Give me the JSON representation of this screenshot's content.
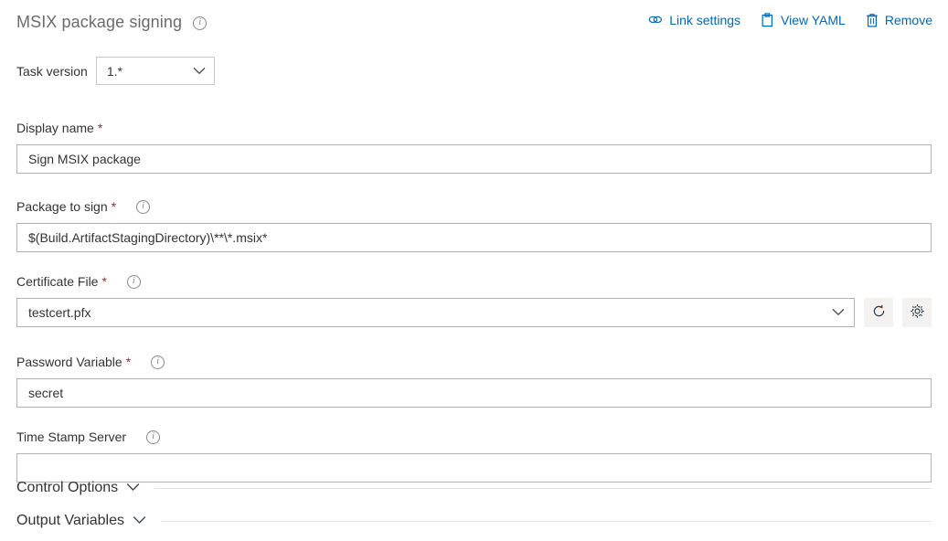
{
  "header": {
    "title": "MSIX package signing",
    "info_icon": "info-icon",
    "actions": [
      {
        "label": "Link settings",
        "icon": "link-icon"
      },
      {
        "label": "View YAML",
        "icon": "clipboard-icon"
      },
      {
        "label": "Remove",
        "icon": "trash-icon"
      }
    ]
  },
  "task_version": {
    "label": "Task version",
    "value": "1.*",
    "chevron_icon": "chevron-down-icon"
  },
  "fields": {
    "display_name": {
      "label": "Display name",
      "required": "*",
      "value": "Sign MSIX package"
    },
    "package_to_sign": {
      "label": "Package to sign",
      "required": "*",
      "info_icon": "info-icon",
      "value": "$(Build.ArtifactStagingDirectory)\\**\\*.msix*"
    },
    "certificate_file": {
      "label": "Certificate File",
      "required": "*",
      "info_icon": "info-icon",
      "value": "testcert.pfx",
      "chevron_icon": "chevron-down-icon",
      "refresh_button": "refresh-icon",
      "settings_button": "gear-icon"
    },
    "password_variable": {
      "label": "Password Variable",
      "required": "*",
      "info_icon": "info-icon",
      "value": "secret"
    },
    "time_stamp_server": {
      "label": "Time Stamp Server",
      "info_icon": "info-icon",
      "value": ""
    }
  },
  "sections": [
    {
      "title": "Control Options",
      "chevron_icon": "chevron-down-icon"
    },
    {
      "title": "Output Variables",
      "chevron_icon": "chevron-down-icon"
    }
  ],
  "colors": {
    "link_blue": "#0068b8",
    "required_red": "#a4262c",
    "title_gray": "#6b6b6b",
    "border_gray": "#b3b3b3"
  }
}
